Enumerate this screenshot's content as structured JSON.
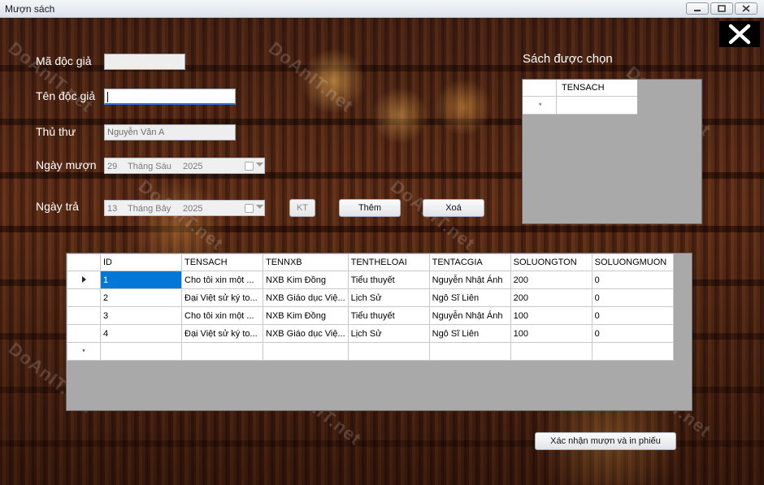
{
  "window": {
    "title": "Mượn sách"
  },
  "watermark": "DoAnIT.net",
  "form": {
    "reader_id_label": "Mã độc giả",
    "reader_id_value": "",
    "reader_name_label": "Tên độc giả",
    "reader_name_value": "",
    "librarian_label": "Thủ thư",
    "librarian_value": "Nguyễn Văn A",
    "borrow_date_label": "Ngày mượn",
    "borrow_date": {
      "day": "29",
      "month": "Tháng Sáu",
      "year": "2025"
    },
    "return_date_label": "Ngày trả",
    "return_date": {
      "day": "13",
      "month": "Tháng Bảy",
      "year": "2025"
    }
  },
  "buttons": {
    "check_label": "KT",
    "add_label": "Thêm",
    "delete_label": "Xoá",
    "confirm_label": "Xác nhận mượn và in phiếu"
  },
  "selected_books": {
    "title": "Sách được chọn",
    "columns": [
      "TENSACH"
    ],
    "new_row_marker": "*"
  },
  "books_table": {
    "columns": [
      "ID",
      "TENSACH",
      "TENNXB",
      "TENTHELOAI",
      "TENTACGIA",
      "SOLUONGTON",
      "SOLUONGMUON"
    ],
    "rows": [
      [
        "1",
        "Cho tôi xin một ...",
        "NXB Kim Đồng",
        "Tiểu thuyết",
        "Nguyễn Nhật Ánh",
        "200",
        "0"
      ],
      [
        "2",
        "Đại Việt sử ký to...",
        "NXB Giáo dục Việ...",
        "Lịch Sử",
        "Ngô Sĩ Liên",
        "200",
        "0"
      ],
      [
        "3",
        "Cho tôi xin một ...",
        "NXB Kim Đồng",
        "Tiểu thuyết",
        "Nguyễn Nhật Ánh",
        "100",
        "0"
      ],
      [
        "4",
        "Đại Việt sử ký to...",
        "NXB Giáo dục Việ...",
        "Lịch Sử",
        "Ngô Sĩ Liên",
        "100",
        "0"
      ]
    ],
    "new_row_marker": "*"
  },
  "colors": {
    "selection": "#0078d7",
    "grid_background": "#a9a9a9",
    "label_text": "#ffffff"
  }
}
